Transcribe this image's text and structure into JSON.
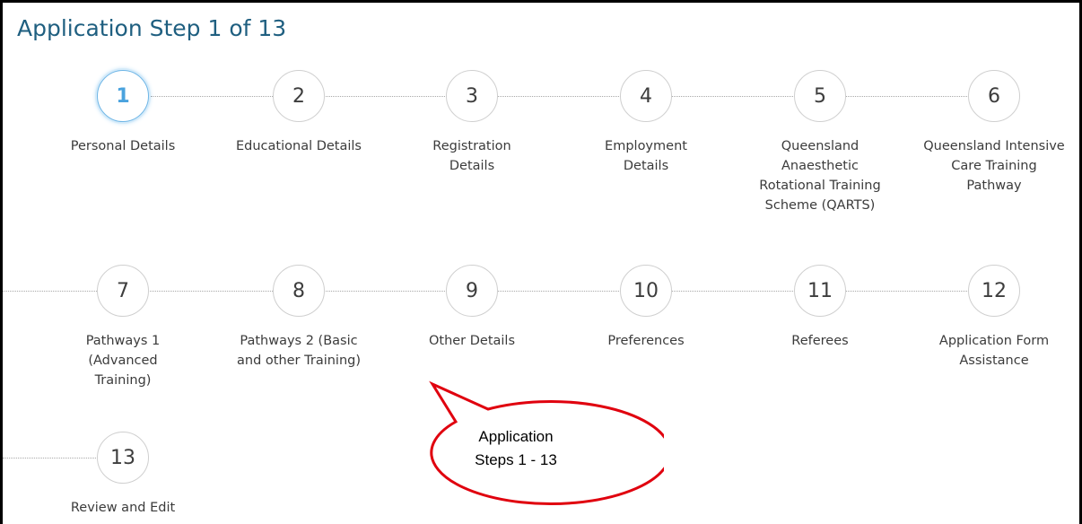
{
  "page_title": "Application Step 1 of 13",
  "steps": [
    {
      "number": "1",
      "label": "Personal Details",
      "active": true
    },
    {
      "number": "2",
      "label": "Educational Details"
    },
    {
      "number": "3",
      "label": "Registration Details"
    },
    {
      "number": "4",
      "label": "Employment Details"
    },
    {
      "number": "5",
      "label": "Queensland Anaesthetic Rotational Training Scheme (QARTS)"
    },
    {
      "number": "6",
      "label": "Queensland Intensive Care Training Pathway"
    },
    {
      "number": "7",
      "label": "Pathways 1 (Advanced Training)"
    },
    {
      "number": "8",
      "label": "Pathways 2 (Basic and other Training)"
    },
    {
      "number": "9",
      "label": "Other Details"
    },
    {
      "number": "10",
      "label": "Preferences"
    },
    {
      "number": "11",
      "label": "Referees"
    },
    {
      "number": "12",
      "label": "Application Form Assistance"
    },
    {
      "number": "13",
      "label": "Review and Edit"
    }
  ],
  "callout": {
    "line1": "Application",
    "line2": "Steps 1 - 13"
  },
  "colors": {
    "title": "#1f5f80",
    "active_step": "#4aa3de",
    "callout_border": "#e0000e"
  }
}
